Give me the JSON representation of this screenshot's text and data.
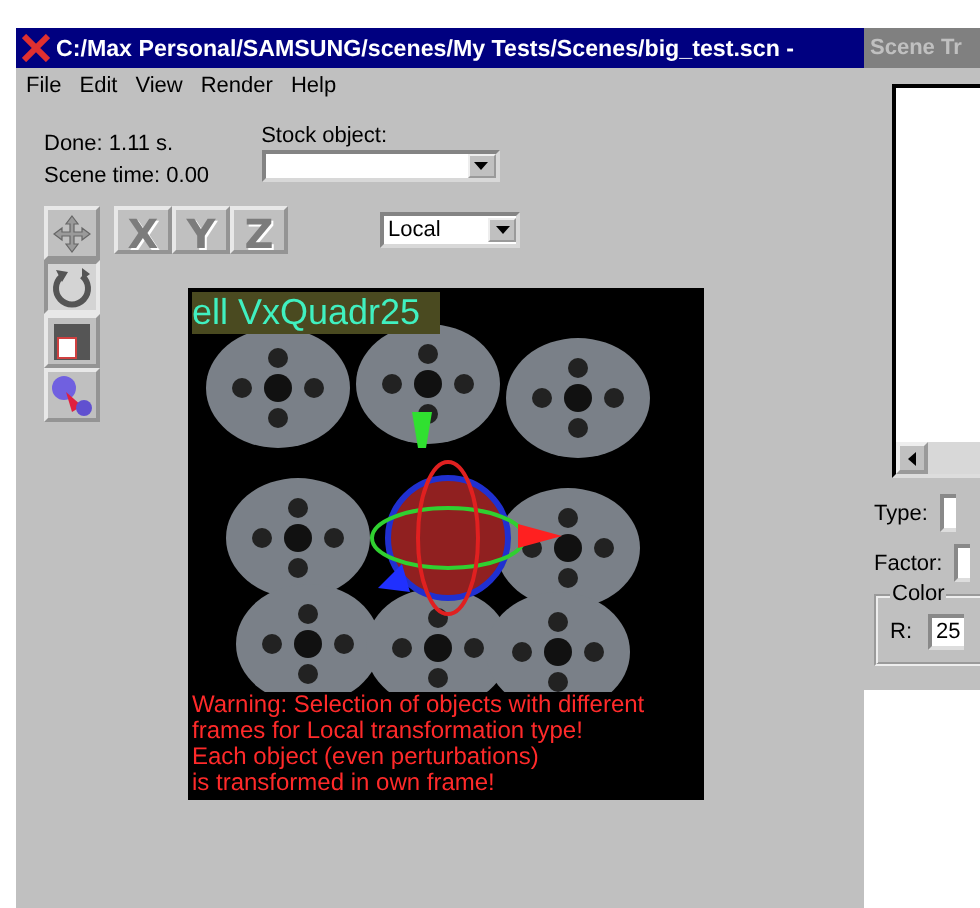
{
  "main_window": {
    "title": "C:/Max Personal/SAMSUNG/scenes/My Tests/Scenes/big_test.scn -",
    "active": true
  },
  "menu": [
    "File",
    "Edit",
    "View",
    "Render",
    "Help"
  ],
  "status": {
    "done": "Done: 1.11 s.",
    "scene_time": "Scene time: 0.00"
  },
  "stock_object": {
    "label": "Stock object:"
  },
  "frame_select": {
    "value": "Local"
  },
  "tools": [
    {
      "kind": "move",
      "selected": false
    },
    {
      "kind": "rotate",
      "selected": true
    },
    {
      "kind": "scale",
      "selected": false
    },
    {
      "kind": "link",
      "selected": false
    }
  ],
  "axes": [
    {
      "label": "X",
      "selected": false
    },
    {
      "label": "Y",
      "selected": false
    },
    {
      "label": "Z",
      "selected": false
    }
  ],
  "viewport": {
    "caption": "ell VxQuadr25",
    "warnings": [
      "Warning: Selection of objects with different",
      "frames for Local transformation type!",
      "Each object (even perturbations)",
      "is transformed in own frame!"
    ]
  },
  "scene_tree": {
    "title": "Scene Tr",
    "active": false,
    "type_label": "Type:",
    "factor_label": "Factor:",
    "color_group": "Color",
    "r_label": "R:",
    "r_value": "25"
  }
}
